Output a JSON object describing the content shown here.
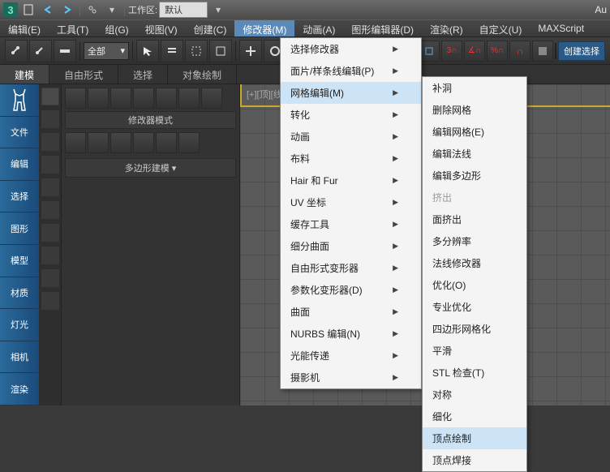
{
  "titlebar": {
    "workspace_label": "工作区:",
    "workspace_value": "默认",
    "right_text": "Au"
  },
  "menubar": {
    "items": [
      "编辑(E)",
      "工具(T)",
      "组(G)",
      "视图(V)",
      "创建(C)",
      "修改器(M)",
      "动画(A)",
      "图形编辑器(D)",
      "渲染(R)",
      "自定义(U)",
      "MAXScript"
    ]
  },
  "toolbar": {
    "filter_label": "全部",
    "create_btn": "创建选择"
  },
  "secondbar": {
    "tabs": [
      "建模",
      "自由形式",
      "选择",
      "对象绘制"
    ]
  },
  "left_nav": {
    "items": [
      "",
      "文件",
      "编辑",
      "选择",
      "图形",
      "模型",
      "材质",
      "灯光",
      "相机",
      "渲染"
    ]
  },
  "tool_panel": {
    "modifier_label": "修改器模式",
    "header": "多边形建模"
  },
  "viewport": {
    "label": "[+][顶][线框]"
  },
  "menu1": {
    "items": [
      {
        "label": "选择修改器",
        "arrow": true
      },
      {
        "label": "面片/样条线编辑(P)",
        "arrow": true
      },
      {
        "label": "网格编辑(M)",
        "arrow": true,
        "hl": true
      },
      {
        "label": "转化",
        "arrow": true
      },
      {
        "label": "动画",
        "arrow": true
      },
      {
        "label": "布料",
        "arrow": true
      },
      {
        "label": "Hair 和 Fur",
        "arrow": true
      },
      {
        "label": "UV 坐标",
        "arrow": true
      },
      {
        "label": "缓存工具",
        "arrow": true
      },
      {
        "label": "细分曲面",
        "arrow": true
      },
      {
        "label": "自由形式变形器",
        "arrow": true
      },
      {
        "label": "参数化变形器(D)",
        "arrow": true
      },
      {
        "label": "曲面",
        "arrow": true
      },
      {
        "label": "NURBS 编辑(N)",
        "arrow": true
      },
      {
        "label": "光能传递",
        "arrow": true
      },
      {
        "label": "摄影机",
        "arrow": true
      }
    ]
  },
  "menu2": {
    "items": [
      {
        "label": "补洞"
      },
      {
        "label": "删除网格"
      },
      {
        "label": "编辑网格(E)"
      },
      {
        "label": "编辑法线"
      },
      {
        "label": "编辑多边形"
      },
      {
        "label": "挤出",
        "disabled": true
      },
      {
        "label": "面挤出"
      },
      {
        "label": "多分辨率"
      },
      {
        "label": "法线修改器"
      },
      {
        "label": "优化(O)"
      },
      {
        "label": "专业优化"
      },
      {
        "label": "四边形网格化"
      },
      {
        "label": "平滑"
      },
      {
        "label": "STL 检查(T)"
      },
      {
        "label": "对称"
      },
      {
        "label": "细化"
      },
      {
        "label": "顶点绘制",
        "hl": true
      },
      {
        "label": "顶点焊接"
      }
    ]
  }
}
